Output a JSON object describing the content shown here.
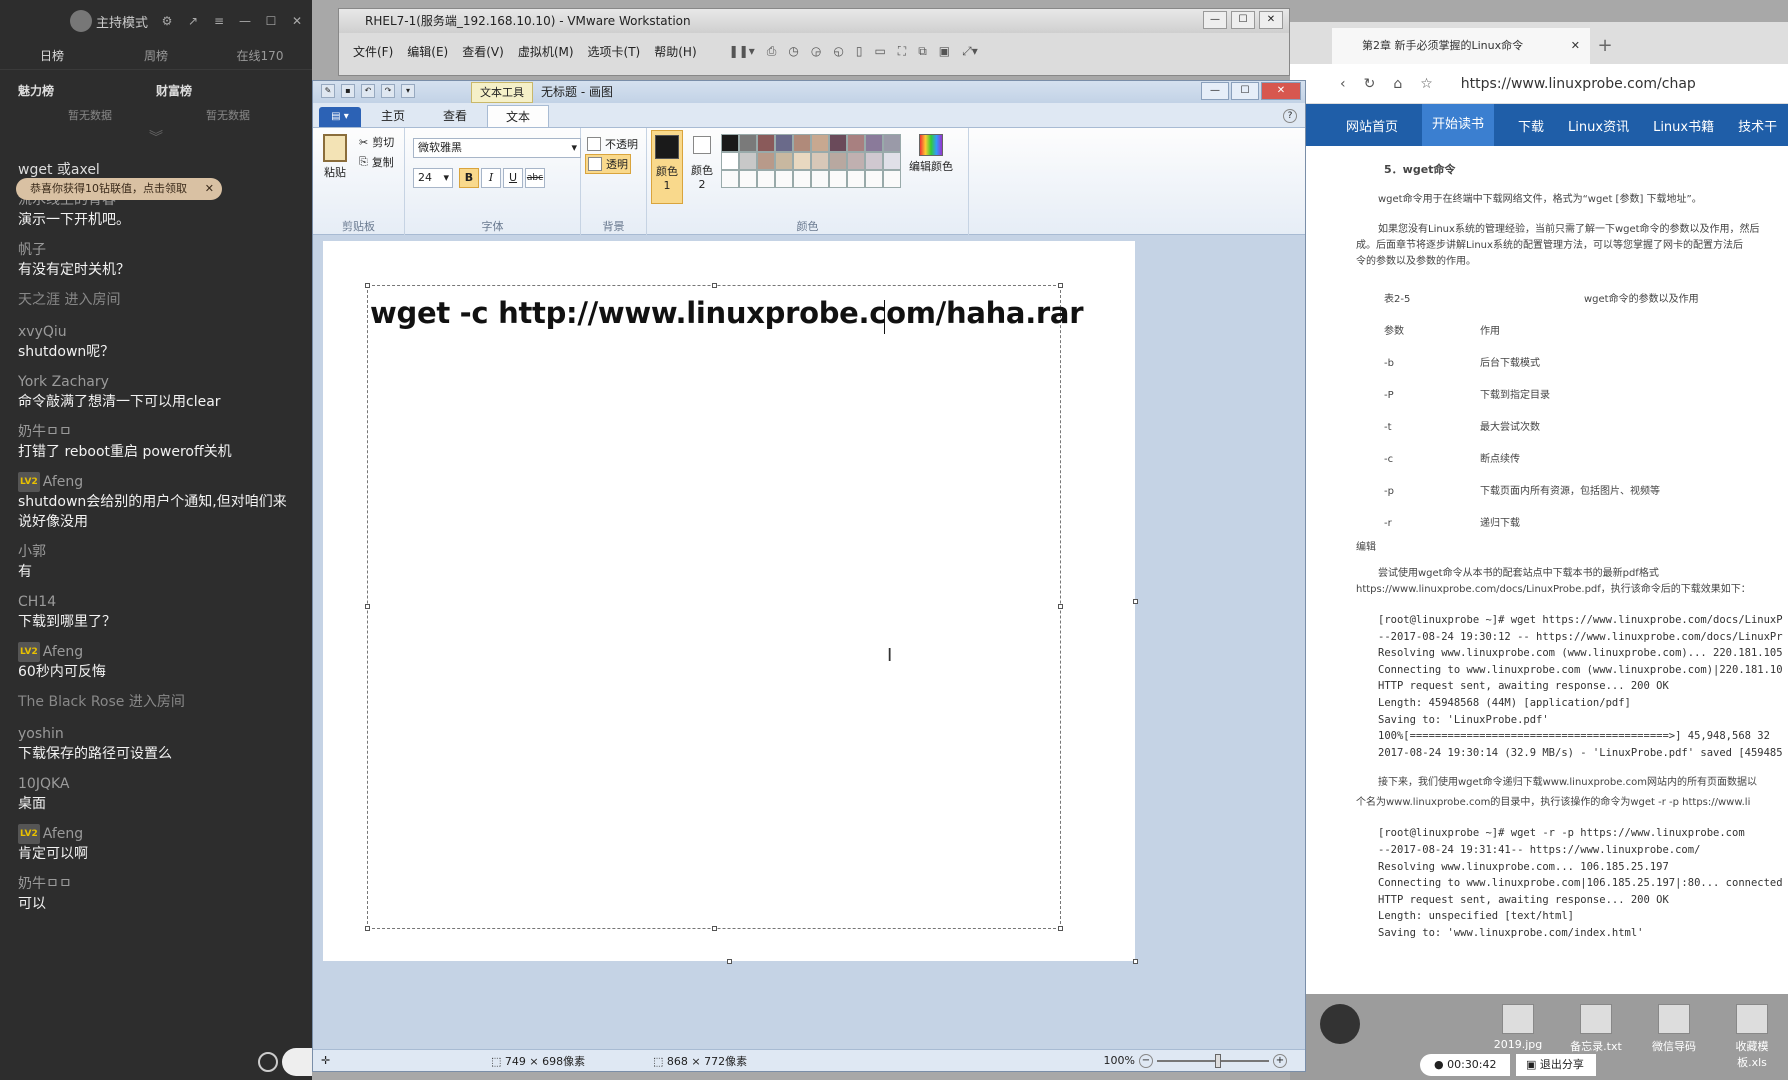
{
  "chat": {
    "mode": "主持模式",
    "tabs": [
      "日榜",
      "周榜",
      "在线170"
    ],
    "rank_left": "魅力榜",
    "rank_right": "财富榜",
    "no_data": "暂无数据",
    "toast": "恭喜你获得10钻联值，点击领取",
    "messages": [
      {
        "user": "wget 或axel",
        "text": ""
      },
      {
        "user": "流水线上的青春",
        "text": "演示一下开机吧。"
      },
      {
        "user": "帆子",
        "text": "有没有定时关机？"
      },
      {
        "system": "天之涯 进入房间"
      },
      {
        "user": "xvyQiu",
        "text": "shutdown呢？"
      },
      {
        "user": "York Zachary",
        "text": "命令敲满了想清一下可以用clear"
      },
      {
        "user": "奶牛ㅁㅁ",
        "text": "打错了 reboot重启 poweroff关机"
      },
      {
        "level": "LV2",
        "user": "Afeng",
        "text": "shutdown会给别的用户个通知,但对咱们来说好像没用"
      },
      {
        "user": "小郭",
        "text": "有"
      },
      {
        "user": "CH14",
        "text": "下载到哪里了？"
      },
      {
        "level": "LV2",
        "user": "Afeng",
        "text": "60秒内可反悔"
      },
      {
        "system": "The Black Rose 进入房间"
      },
      {
        "user": "yoshin",
        "text": "下载保存的路径可设置么"
      },
      {
        "user": "10JQKA",
        "text": "桌面"
      },
      {
        "level": "LV2",
        "user": "Afeng",
        "text": "肯定可以啊"
      },
      {
        "user": "奶牛ㅁㅁ",
        "text": "可以"
      }
    ]
  },
  "vmware": {
    "title": "RHEL7-1(服务端_192.168.10.10) - VMware Workstation",
    "menu": [
      "文件(F)",
      "编辑(E)",
      "查看(V)",
      "虚拟机(M)",
      "选项卡(T)",
      "帮助(H)"
    ]
  },
  "paint": {
    "context_tab": "文本工具",
    "title": "无标题 - 画图",
    "tabs": [
      "主页",
      "查看",
      "文本"
    ],
    "clipboard": {
      "paste": "粘贴",
      "cut": "剪切",
      "copy": "复制",
      "label": "剪贴板"
    },
    "font": {
      "name": "微软雅黑",
      "size": "24",
      "label": "字体"
    },
    "background": {
      "opaque": "不透明",
      "transparent": "透明",
      "label": "背景"
    },
    "colors": {
      "color1": "颜色 1",
      "color2": "颜色 2",
      "edit": "编辑颜色",
      "label": "颜色"
    },
    "typed_text": "wget -c http://www.linuxprobe.com/haha.rar",
    "status": {
      "selection": "749 × 698像素",
      "image_size": "868 × 772像素",
      "zoom": "100%"
    }
  },
  "browser": {
    "tab_title": "第2章 新手必须掌握的Linux命令",
    "url": "https://www.linuxprobe.com/chap",
    "nav": [
      "网站首页",
      "开始读书",
      "下载",
      "Linux资讯",
      "Linux书籍",
      "技术干"
    ],
    "heading": "5．wget命令",
    "p1": "wget命令用于在终端中下载网络文件，格式为“wget [参数] 下载地址”。",
    "p2a": "如果您没有Linux系统的管理经验，当前只需了解一下wget命令的参数以及作用，然后",
    "p2b": "成。后面章节将逐步讲解Linux系统的配置管理方法，可以等您掌握了网卡的配置方法后",
    "p2c": "令的参数以及参数的作用。",
    "table_caption": "表2-5",
    "table_title": "wget命令的参数以及作用",
    "table_head": [
      "参数",
      "作用"
    ],
    "table_rows": [
      [
        "-b",
        "后台下载模式"
      ],
      [
        "-P",
        "下载到指定目录"
      ],
      [
        "-t",
        "最大尝试次数"
      ],
      [
        "-c",
        "断点续传"
      ],
      [
        "-p",
        "下载页面内所有资源，包括图片、视频等"
      ],
      [
        "-r",
        "递归下载"
      ]
    ],
    "edit": "编辑",
    "p3": "尝试使用wget命令从本书的配套站点中下载本书的最新pdf格式",
    "p3b": "https://www.linuxprobe.com/docs/LinuxProbe.pdf，执行该命令后的下载效果如下：",
    "code1": [
      "[root@linuxprobe ~]# wget https://www.linuxprobe.com/docs/LinuxP",
      "--2017-08-24 19:30:12 -- https://www.linuxprobe.com/docs/LinuxPr",
      "Resolving www.linuxprobe.com (www.linuxprobe.com)... 220.181.105",
      "Connecting to www.linuxprobe.com (www.linuxprobe.com)|220.181.10",
      "HTTP request sent, awaiting response... 200 OK",
      "Length: 45948568 (44M) [application/pdf]",
      "Saving to: 'LinuxProbe.pdf'",
      "100%[=========================================>] 45,948,568 32",
      "2017-08-24 19:30:14 (32.9 MB/s) - 'LinuxProbe.pdf' saved [459485"
    ],
    "p4": "接下来，我们使用wget命令递归下载www.linuxprobe.com网站内的所有页面数据以",
    "p4b": "个名为www.linuxprobe.com的目录中，执行该操作的命令为wget -r -p https://www.li",
    "code2": [
      "[root@linuxprobe ~]# wget -r -p https://www.linuxprobe.com",
      "--2017-08-24 19:31:41-- https://www.linuxprobe.com/",
      "Resolving www.linuxprobe.com... 106.185.25.197",
      "Connecting to www.linuxprobe.com|106.185.25.197|:80... connected",
      "HTTP request sent, awaiting response... 200 OK",
      "Length: unspecified [text/html]",
      "Saving to: 'www.linuxprobe.com/index.html'"
    ]
  },
  "tray": {
    "files": [
      "2019.jpg",
      "备忘录.txt",
      "微信导码",
      "收藏模板.xls"
    ],
    "timer": "00:30:42",
    "share": "退出分享"
  }
}
